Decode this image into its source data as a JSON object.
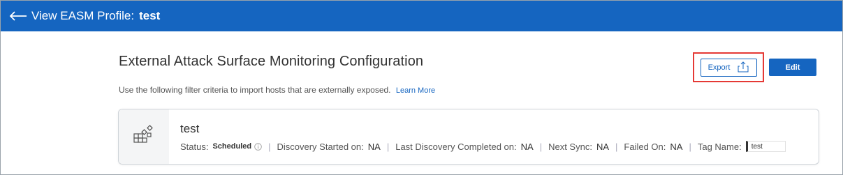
{
  "header": {
    "title_prefix": "View EASM Profile:",
    "profile_name": "test"
  },
  "main": {
    "heading": "External Attack Surface Monitoring Configuration",
    "description": "Use the following filter criteria to import hosts that are externally exposed.",
    "learn_more": "Learn More"
  },
  "actions": {
    "export_label": "Export",
    "edit_label": "Edit"
  },
  "profile_card": {
    "name": "test",
    "status_label": "Status:",
    "status_value": "Scheduled",
    "discovery_started_label": "Discovery Started on:",
    "discovery_started_value": "NA",
    "last_discovery_label": "Last Discovery Completed on:",
    "last_discovery_value": "NA",
    "next_sync_label": "Next Sync:",
    "next_sync_value": "NA",
    "failed_on_label": "Failed On:",
    "failed_on_value": "NA",
    "tag_name_label": "Tag Name:",
    "tag_name_value": "test"
  },
  "colors": {
    "primary": "#1565c0",
    "highlight": "#e53935"
  },
  "icons": {
    "back": "arrow-left-icon",
    "export": "upload-icon",
    "status_info": "info-icon",
    "profile": "grid-diamond-icon"
  }
}
